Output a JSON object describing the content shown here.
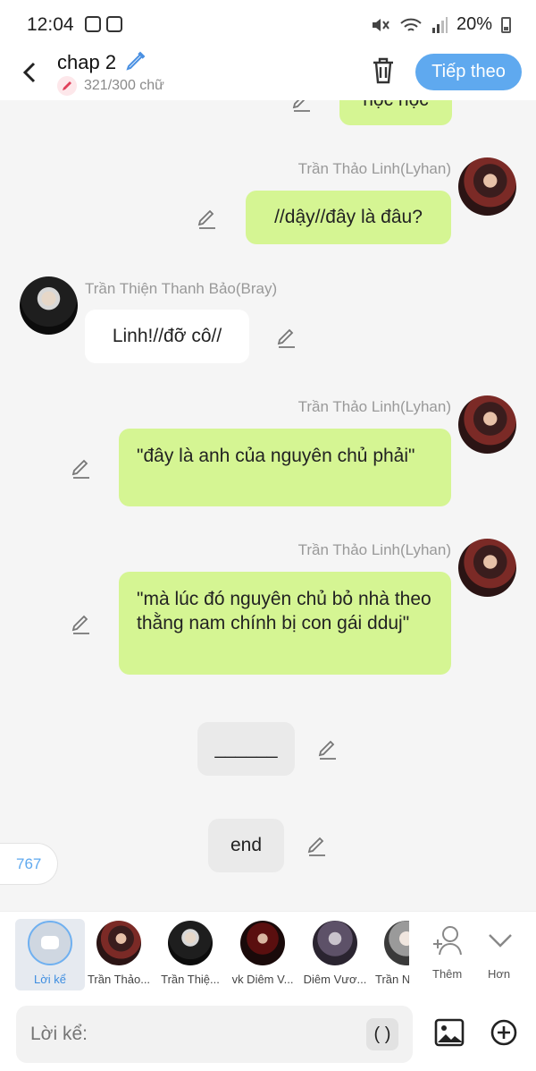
{
  "status_bar": {
    "time": "12:04",
    "battery": "20%"
  },
  "header": {
    "title": "chap 2",
    "word_count": "321/300 chữ",
    "next_label": "Tiếp theo"
  },
  "messages": {
    "partial": "học học",
    "m1": {
      "name": "Trần Thảo Linh(Lyhan)",
      "text": "//dậy//đây là đâu?"
    },
    "m2": {
      "name": "Trần Thiện Thanh Bảo(Bray)",
      "text": "Linh!//đỡ cô//"
    },
    "m3": {
      "name": "Trần Thảo Linh(Lyhan)",
      "text": "\"đây là anh của nguyên chủ phải\""
    },
    "m4": {
      "name": "Trần Thảo Linh(Lyhan)",
      "text": "\"mà lúc đó nguyên chủ bỏ nhà theo thằng nam chính bị con gái dduj\""
    },
    "n1": "______",
    "n2": "end"
  },
  "counter": "767",
  "characters": [
    {
      "label": "Lời kể"
    },
    {
      "label": "Trần Thảo..."
    },
    {
      "label": "Trần Thiệ..."
    },
    {
      "label": "vk Diêm V..."
    },
    {
      "label": "Diêm Vươ..."
    },
    {
      "label": "Trần N"
    }
  ],
  "actions": {
    "add": "Thêm",
    "more": "Hơn"
  },
  "input": {
    "placeholder": "Lời kể:",
    "paren": "( )"
  },
  "colors": {
    "accent": "#5fa9ef",
    "my_bubble": "#d5f593",
    "other_bubble": "#ffffff"
  }
}
